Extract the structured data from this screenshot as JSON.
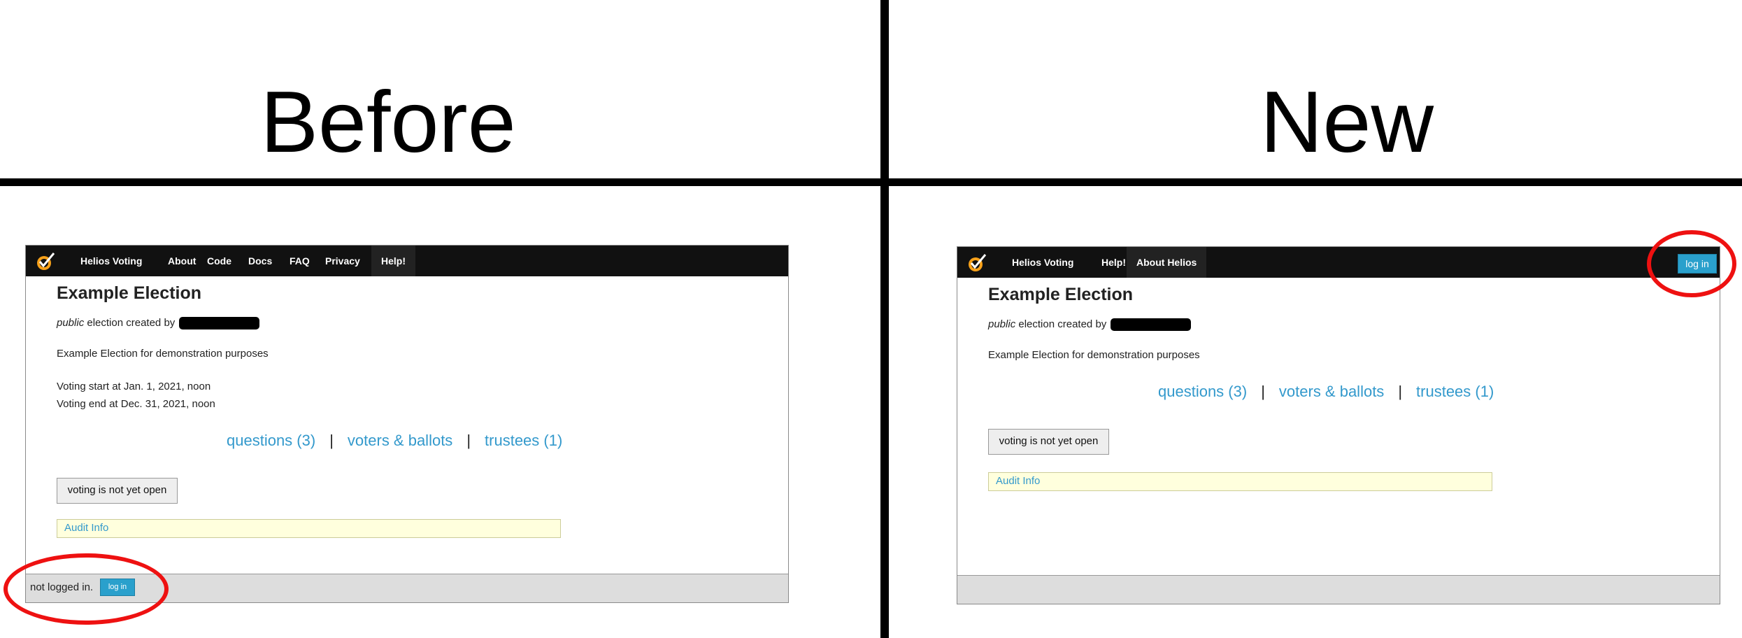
{
  "labels": {
    "before": "Before",
    "new": "New"
  },
  "before": {
    "nav": [
      "Helios Voting",
      "About",
      "Code",
      "Docs",
      "FAQ",
      "Privacy",
      "Help!"
    ],
    "election_title": "Example Election",
    "created_prefix": "public",
    "created_text": " election created by",
    "description": "Example Election for demonstration purposes",
    "voting_start": "Voting start at Jan. 1, 2021, noon",
    "voting_end": "Voting end at Dec. 31, 2021, noon",
    "links": {
      "questions": "questions (3)",
      "voters": "voters & ballots",
      "trustees": "trustees (1)",
      "sep": "|"
    },
    "status_button": "voting is not yet open",
    "audit": "Audit Info",
    "footer_text": "not logged in.",
    "login": "log in"
  },
  "new": {
    "nav": [
      "Helios Voting",
      "Help!",
      "About Helios"
    ],
    "election_title": "Example Election",
    "created_prefix": "public",
    "created_text": " election created by",
    "description": "Example Election for demonstration purposes",
    "links": {
      "questions": "questions (3)",
      "voters": "voters & ballots",
      "trustees": "trustees (1)",
      "sep": "|"
    },
    "status_button": "voting is not yet open",
    "audit": "Audit Info",
    "login": "log in"
  },
  "colors": {
    "accent": "#3399cc",
    "highlight": "#ee1111",
    "navbar": "#111111"
  }
}
